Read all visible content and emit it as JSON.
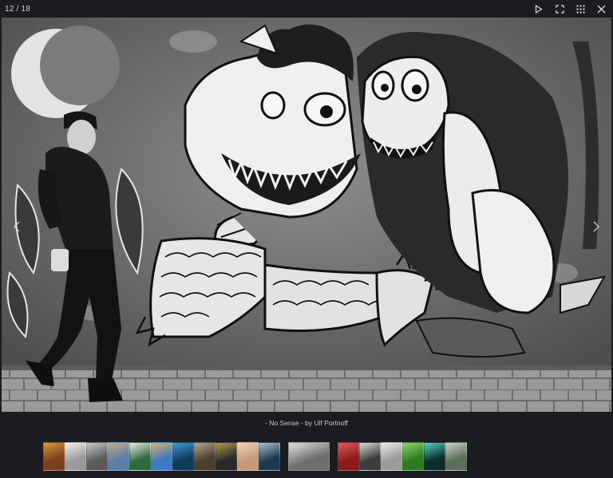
{
  "viewer": {
    "counter": "12 / 18",
    "caption": "- No Sense - by Ulf Portnoff"
  },
  "toolbar": {
    "items": [
      {
        "name": "play-icon"
      },
      {
        "name": "fullscreen-icon"
      },
      {
        "name": "grid-icon"
      },
      {
        "name": "close-icon"
      }
    ]
  },
  "thumbnails": [
    {
      "color": "#7a3f1e",
      "accent": "#d79a3a"
    },
    {
      "color": "#9a9a9a",
      "accent": "#f2f2f2"
    },
    {
      "color": "#5b5b5b",
      "accent": "#c8c8c8"
    },
    {
      "color": "#5a7fa6",
      "accent": "#c9a789"
    },
    {
      "color": "#2f6a3c",
      "accent": "#e8e8e8"
    },
    {
      "color": "#3f78c4",
      "accent": "#d8b26a"
    },
    {
      "color": "#123a5a",
      "accent": "#3d9bd6"
    },
    {
      "color": "#4a4030",
      "accent": "#b3a48a"
    },
    {
      "color": "#2a2a2a",
      "accent": "#b59a4a"
    },
    {
      "color": "#c49a7a",
      "accent": "#f1d2b8"
    },
    {
      "color": "#1f3a4e",
      "accent": "#a7c0cf"
    },
    {
      "color": "#6e6e6e",
      "accent": "#e2e2e2",
      "current": true
    },
    {
      "color": "#8a1b1b",
      "accent": "#e25b5b"
    },
    {
      "color": "#3c3c3c",
      "accent": "#d9d9d9"
    },
    {
      "color": "#9b9b9b",
      "accent": "#e9e9e9"
    },
    {
      "color": "#2e7a22",
      "accent": "#8fd36e"
    },
    {
      "color": "#0f2b2b",
      "accent": "#4fd3c6"
    },
    {
      "color": "#5c6e5a",
      "accent": "#c9d1c4"
    }
  ]
}
